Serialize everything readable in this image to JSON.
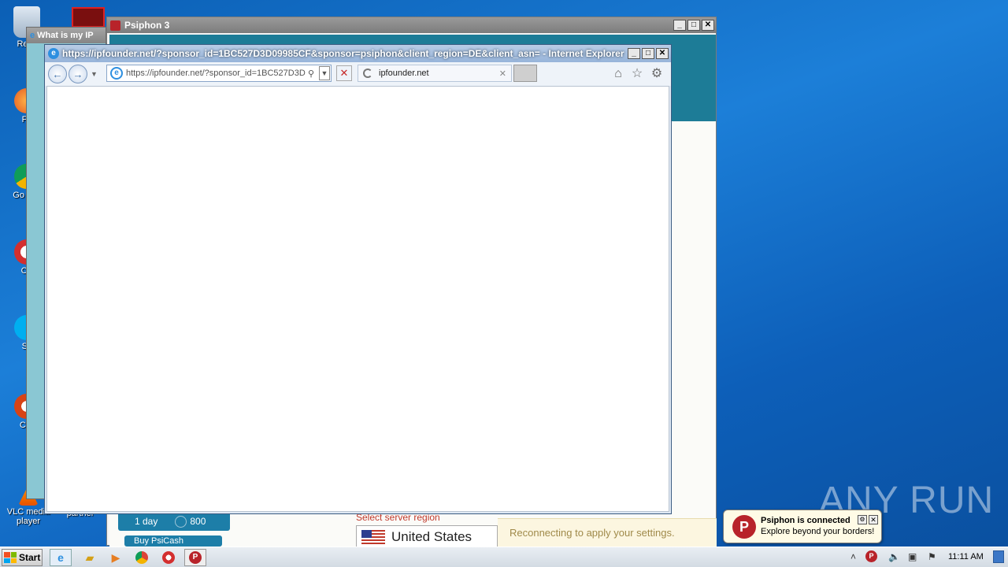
{
  "desktop": {
    "icons": [
      {
        "label": "Recy",
        "name": "recycle-bin"
      },
      {
        "label": "Fir",
        "name": "firefox"
      },
      {
        "label": "Go Chr",
        "name": "chrome"
      },
      {
        "label": "Op",
        "name": "opera"
      },
      {
        "label": "Sk",
        "name": "skype"
      },
      {
        "label": "CCl",
        "name": "ccleaner"
      },
      {
        "label": "VLC media player",
        "name": "vlc"
      },
      {
        "label": "partner",
        "name": "partner"
      }
    ],
    "watermark": "ANY RUN"
  },
  "psiphon": {
    "title": "Psiphon 3",
    "plans": [
      {
        "duration": "1 day",
        "price": "800"
      },
      {
        "duration": "Buy PsiCash"
      }
    ],
    "region_label": "Select server region",
    "region_value": "United States",
    "status_message": "Reconnecting to apply your settings."
  },
  "ie_back": {
    "title": "What is my IP"
  },
  "ie_front": {
    "title": "https://ipfounder.net/?sponsor_id=1BC527D3D09985CF&sponsor=psiphon&client_region=DE&client_asn= - Internet Explorer",
    "address": "https://ipfounder.net/?sponsor_id=1BC527D3D",
    "address_domain": "ipfounder.net",
    "tab_label": "ipfounder.net"
  },
  "taskbar": {
    "start_label": "Start",
    "clock": "11:11 AM"
  },
  "notification": {
    "title": "Psiphon is connected",
    "body": "Explore beyond your borders!"
  },
  "colors": {
    "psiphon_accent": "#1d7c97",
    "psiphon_brand": "#b8232a",
    "desktop_blue": "#1c7fd8"
  }
}
